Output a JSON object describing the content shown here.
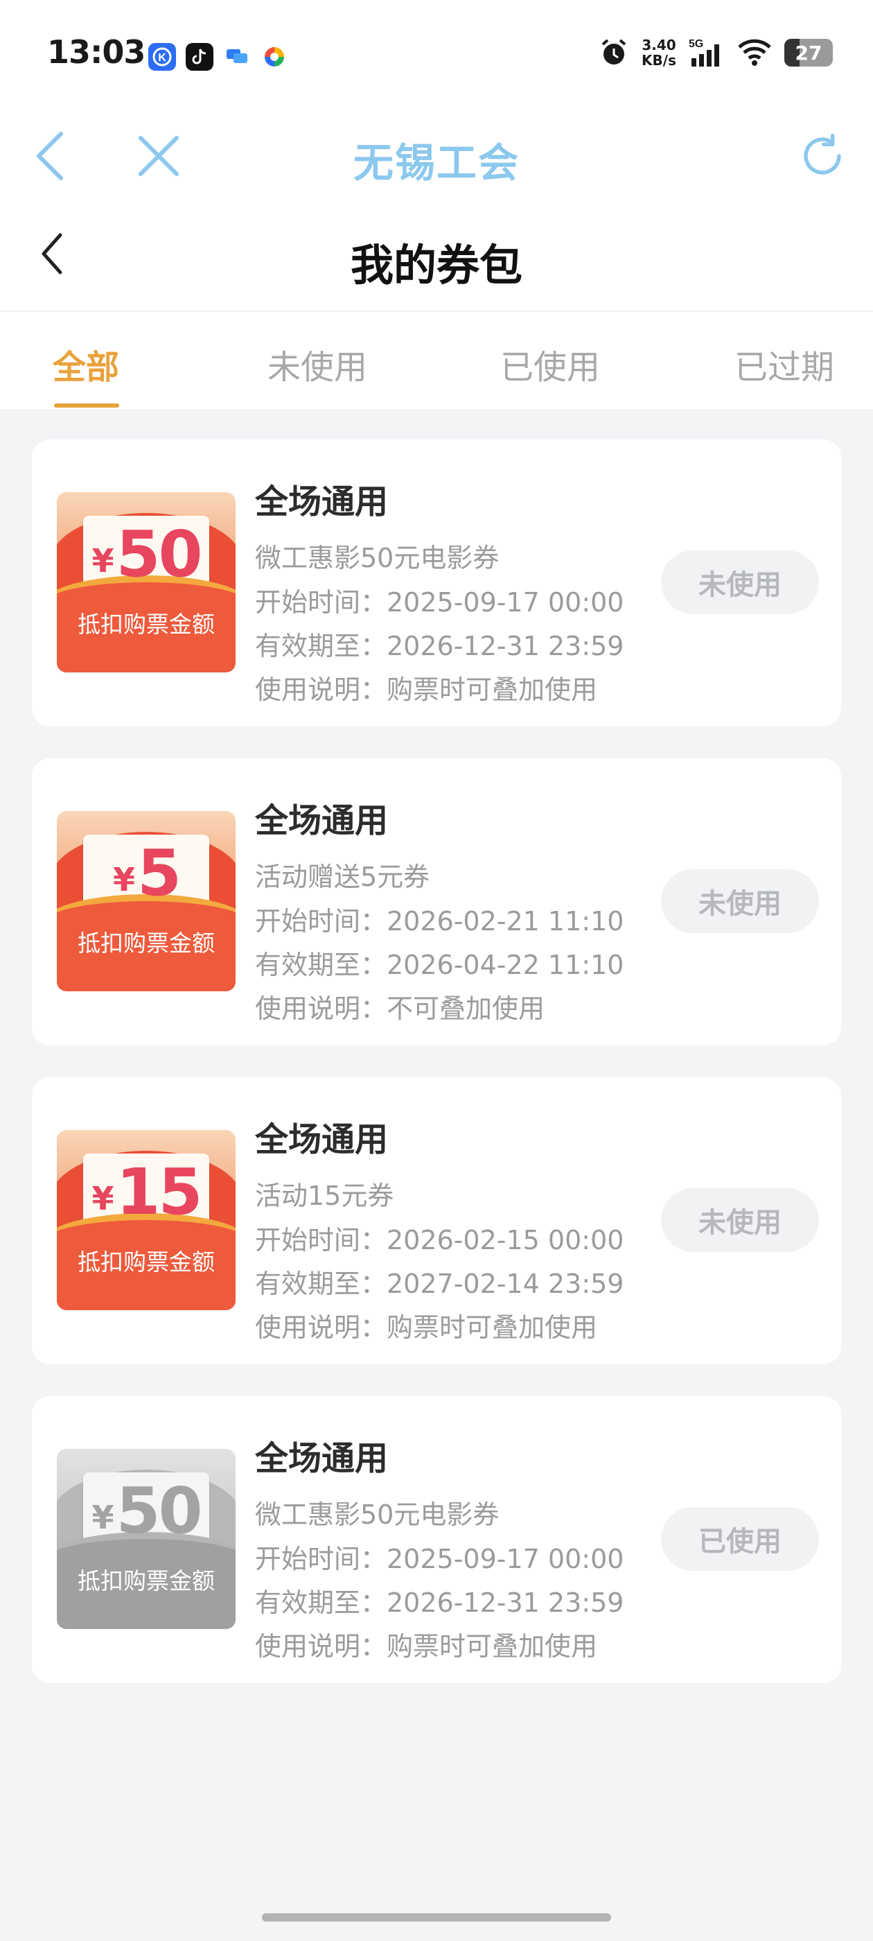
{
  "status_bar": {
    "time": "13:03",
    "net_speed_value": "3.40",
    "net_speed_unit": "KB/s",
    "network": "5G",
    "battery": "27"
  },
  "webview": {
    "title": "无锡工会"
  },
  "header": {
    "title": "我的券包"
  },
  "tabs": [
    {
      "label": "全部",
      "active": true
    },
    {
      "label": "未使用",
      "active": false
    },
    {
      "label": "已使用",
      "active": false
    },
    {
      "label": "已过期",
      "active": false
    }
  ],
  "coupons": [
    {
      "amount": "50",
      "currency": "¥",
      "img_desc": "抵扣购票金额",
      "title": "全场通用",
      "subtitle": "微工惠影50元电影券",
      "start": "开始时间：2025-09-17 00:00",
      "expire": "有效期至：2026-12-31 23:59",
      "note": "使用说明：购票时可叠加使用",
      "status": "未使用"
    },
    {
      "amount": "5",
      "currency": "¥",
      "img_desc": "抵扣购票金额",
      "title": "全场通用",
      "subtitle": "活动赠送5元券",
      "start": "开始时间：2026-02-21 11:10",
      "expire": "有效期至：2026-04-22 11:10",
      "note": "使用说明：不可叠加使用",
      "status": "未使用"
    },
    {
      "amount": "15",
      "currency": "¥",
      "img_desc": "抵扣购票金额",
      "title": "全场通用",
      "subtitle": "活动15元券",
      "start": "开始时间：2026-02-15 00:00",
      "expire": "有效期至：2027-02-14 23:59",
      "note": "使用说明：购票时可叠加使用",
      "status": "未使用"
    },
    {
      "amount": "50",
      "currency": "¥",
      "img_desc": "抵扣购票金额",
      "title": "全场通用",
      "subtitle": "微工惠影50元电影券",
      "start": "开始时间：2025-09-17 00:00",
      "expire": "有效期至：2026-12-31 23:59",
      "note": "使用说明：购票时可叠加使用",
      "status": "已使用"
    }
  ],
  "colors": {
    "accent": "#eaa13b",
    "webview_title": "#8cc8ee",
    "coupon_red": "#ea4f35",
    "coupon_amount": "#e8455f"
  }
}
